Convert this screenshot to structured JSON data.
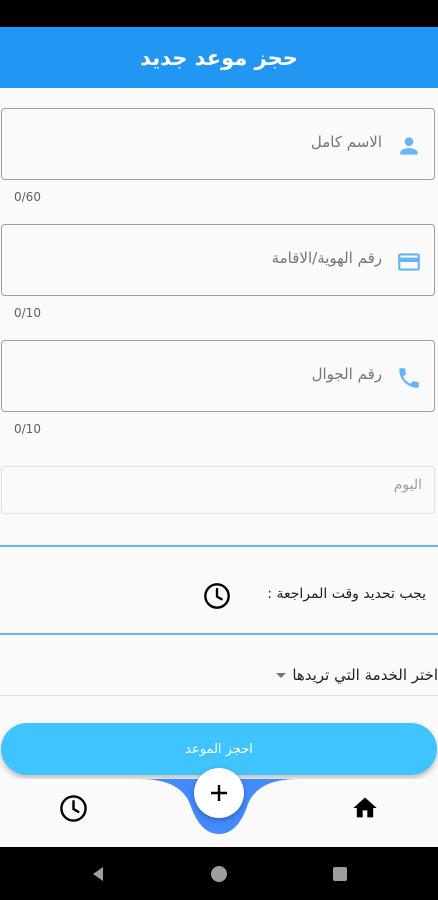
{
  "app_bar": {
    "title": "حجز موعد جديد"
  },
  "form": {
    "full_name": {
      "placeholder": "الاسم كامل",
      "counter": "0/60",
      "icon": "person-icon"
    },
    "id_number": {
      "placeholder": "رقم الهوية/الاقامة",
      "counter": "0/10",
      "icon": "id-card-icon"
    },
    "mobile": {
      "placeholder": "رقم الجوال",
      "counter": "0/10",
      "icon": "phone-icon"
    },
    "day": {
      "placeholder": "اليوم"
    },
    "time_notice": "يجب تحديد وقت المراجعة :",
    "service": {
      "placeholder": "اختر الخدمة التي تريدها"
    },
    "submit_label": "احجز الموعد"
  },
  "bottom_nav": {
    "items": [
      "clock-icon",
      "add-icon",
      "home-icon"
    ]
  },
  "colors": {
    "primary": "#2196f3",
    "accent_button": "#40c4ff",
    "icon_tint": "#64b5f6"
  }
}
